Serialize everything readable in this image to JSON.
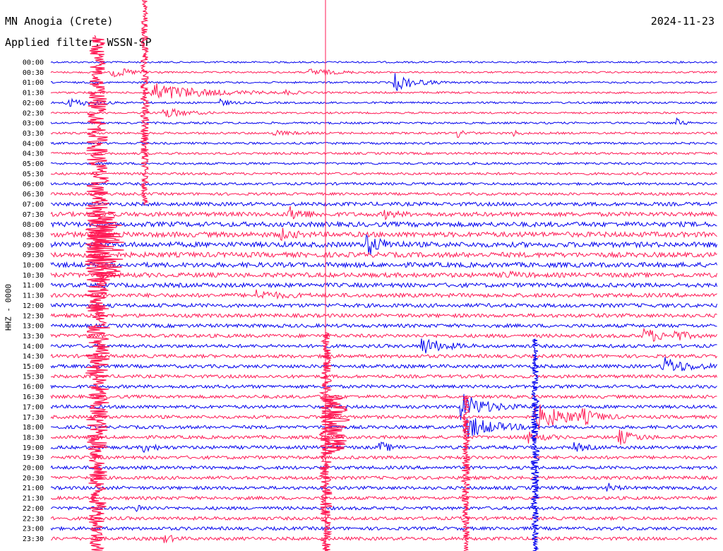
{
  "header": {
    "station": "MN Anogia (Crete)",
    "date": "2024-11-23",
    "filter": "Applied filter: WSSN-SP"
  },
  "chart_data": {
    "type": "line",
    "title": "MN Anogia (Crete)",
    "ylabel": "HHZ - 0000",
    "categories": [
      "00:00",
      "00:30",
      "01:00",
      "01:30",
      "02:00",
      "02:30",
      "03:00",
      "03:30",
      "04:00",
      "04:30",
      "05:00",
      "05:30",
      "06:00",
      "06:30",
      "07:00",
      "07:30",
      "08:00",
      "08:30",
      "09:00",
      "09:30",
      "10:00",
      "10:30",
      "11:00",
      "11:30",
      "12:00",
      "12:30",
      "13:00",
      "13:30",
      "14:00",
      "14:30",
      "15:00",
      "15:30",
      "16:00",
      "16:30",
      "17:00",
      "17:30",
      "18:00",
      "18:30",
      "19:00",
      "19:30",
      "20:00",
      "20:30",
      "21:00",
      "21:30",
      "22:00",
      "22:30",
      "23:00",
      "23:30"
    ],
    "colors": {
      "a": "#0000ee",
      "b": "#ff1a55",
      "marker": "#ff1a55"
    },
    "noise_levels": [
      1.2,
      1.2,
      1.3,
      1.3,
      1.4,
      1.3,
      1.4,
      1.5,
      1.5,
      1.6,
      1.6,
      1.7,
      1.8,
      1.9,
      2.6,
      3.0,
      3.4,
      3.6,
      3.6,
      3.5,
      3.4,
      3.2,
      3.0,
      2.8,
      2.7,
      2.6,
      2.5,
      2.5,
      2.4,
      2.4,
      2.4,
      2.3,
      2.3,
      2.3,
      2.3,
      2.3,
      2.3,
      2.3,
      2.3,
      2.3,
      2.3,
      2.3,
      2.3,
      2.3,
      2.3,
      2.3,
      2.3,
      2.3
    ]
  }
}
